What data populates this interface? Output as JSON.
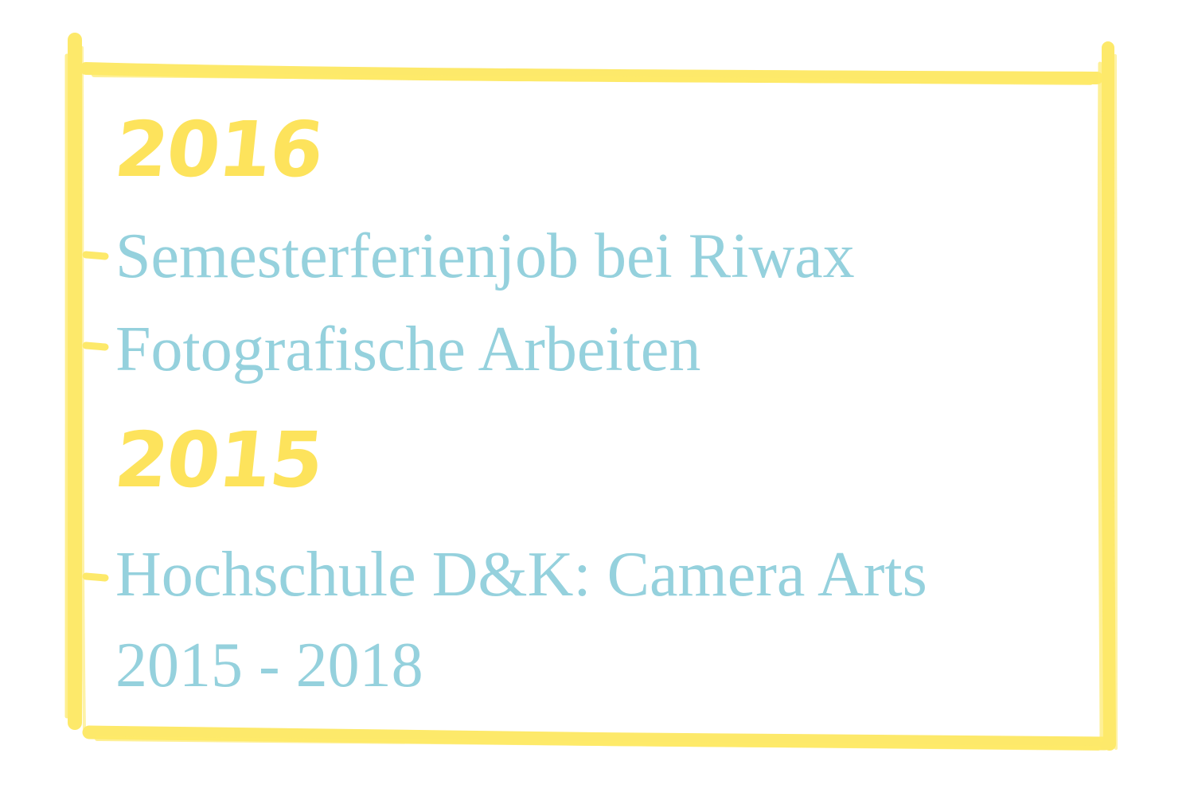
{
  "colors": {
    "frame": "#fde96a",
    "year": "#fde35c",
    "text": "#95d1dd",
    "background": "#ffffff"
  },
  "entries": [
    {
      "year": "2016",
      "lines": [
        "Semesterferienjob bei Riwax",
        "Fotografische Arbeiten"
      ]
    },
    {
      "year": "2015",
      "lines": [
        "Hochschule D&K: Camera Arts",
        "2015 - 2018"
      ]
    }
  ]
}
